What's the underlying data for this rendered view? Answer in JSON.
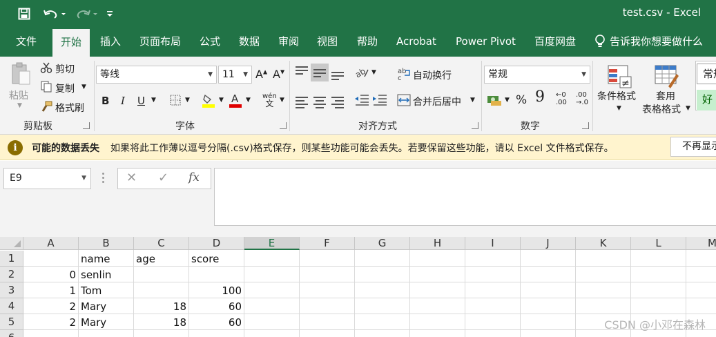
{
  "window": {
    "title": "test.csv  -  Excel"
  },
  "tabs": [
    "文件",
    "开始",
    "插入",
    "页面布局",
    "公式",
    "数据",
    "审阅",
    "视图",
    "帮助",
    "Acrobat",
    "Power Pivot",
    "百度网盘",
    "告诉我你想要做什么"
  ],
  "ribbon": {
    "clipboard": {
      "paste": "粘贴",
      "cut": "剪切",
      "copy": "复制",
      "format_painter": "格式刷",
      "group_label": "剪贴板"
    },
    "font": {
      "name": "等线",
      "size": "11",
      "group_label": "字体",
      "bold": "B",
      "italic": "I",
      "underline": "U",
      "grow": "A",
      "shrink": "A",
      "phonetic": "wén",
      "font_color": "#e00000",
      "fill_color": "#ffff00"
    },
    "alignment": {
      "wrap_text": "自动换行",
      "merge_center": "合并后居中",
      "group_label": "对齐方式"
    },
    "number": {
      "format": "常规",
      "percent": "%",
      "comma": "9",
      "group_label": "数字",
      "inc_decimal": ".00",
      "dec_decimal": ".0"
    },
    "styles": {
      "conditional_format": "条件格式",
      "format_as_table_1": "套用",
      "format_as_table_2": "表格格式",
      "style_normal": "常规",
      "style_good": "好"
    }
  },
  "infobar": {
    "title": "可能的数据丢失",
    "message": "如果将此工作薄以逗号分隔(.csv)格式保存，则某些功能可能会丢失。若要保留这些功能，请以 Excel 文件格式保存。",
    "button": "不再显示"
  },
  "formula_bar": {
    "name_box": "E9",
    "fx": "fx",
    "content": ""
  },
  "sheet": {
    "columns": [
      "A",
      "B",
      "C",
      "D",
      "E",
      "F",
      "G",
      "H",
      "I",
      "J",
      "K",
      "L",
      "M"
    ],
    "active_column": "E",
    "rows": [
      "1",
      "2",
      "3",
      "4",
      "5",
      "6"
    ],
    "cells": {
      "B1": "name",
      "C1": "age",
      "D1": "score",
      "A2": "0",
      "B2": "senlin",
      "A3": "1",
      "B3": "Tom",
      "D3": "100",
      "A4": "2",
      "B4": "Mary",
      "C4": "18",
      "D4": "60",
      "A5": "2",
      "B5": "Mary",
      "C5": "18",
      "D5": "60"
    }
  },
  "watermark": "CSDN @小邓在森林"
}
